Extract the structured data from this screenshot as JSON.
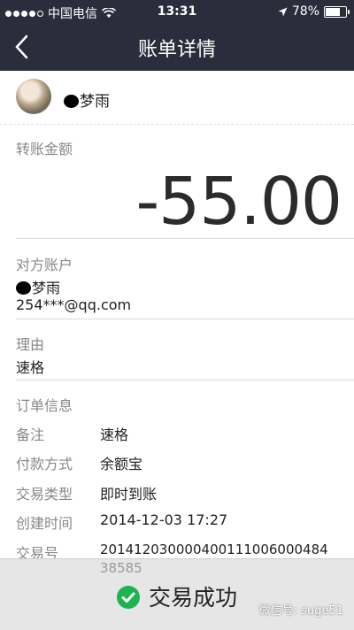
{
  "status_bar": {
    "carrier": "中国电信",
    "time": "13:31",
    "battery": "78%",
    "battery_level": 0.78
  },
  "header": {
    "title": "账单详情"
  },
  "user": {
    "name": "梦雨"
  },
  "amount": {
    "label": "转账金额",
    "value": "-55.00"
  },
  "account": {
    "label": "对方账户",
    "name": "梦雨",
    "email": "254***@qq.com"
  },
  "reason": {
    "label": "理由",
    "value": "速格"
  },
  "order": {
    "title": "订单信息",
    "rows": [
      {
        "label": "备注",
        "value": "速格"
      },
      {
        "label": "付款方式",
        "value": "余额宝"
      },
      {
        "label": "交易类型",
        "value": "即时到账"
      },
      {
        "label": "创建时间",
        "value": "2014-12-03 17:27"
      },
      {
        "label": "交易号",
        "value": "201412030000400111006000484"
      }
    ],
    "trade_no_tail": "38585"
  },
  "footer": {
    "status": "交易成功",
    "watermark": "微信号: suge51",
    "accent": "#1db34f"
  }
}
